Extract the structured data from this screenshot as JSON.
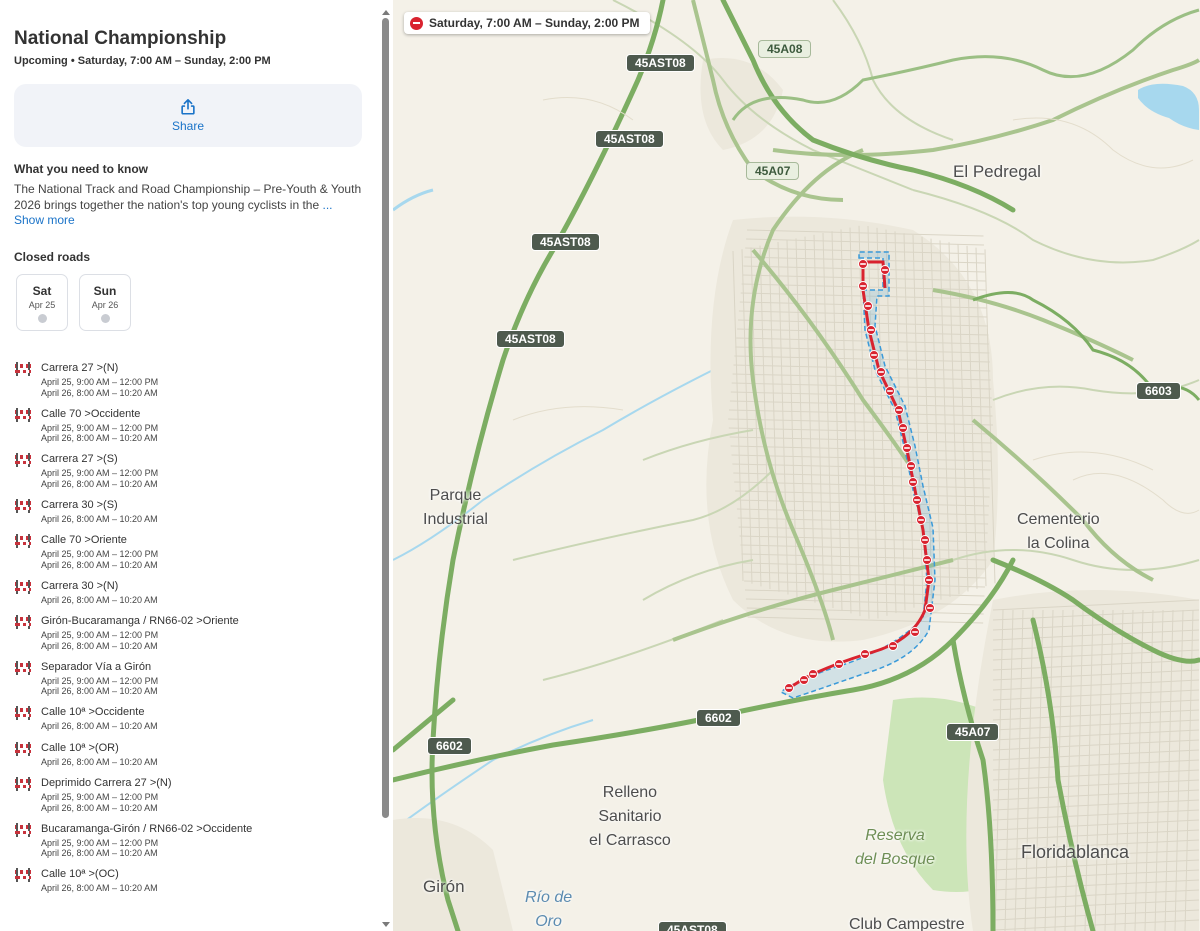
{
  "event": {
    "title": "National Championship",
    "subtitle": "Upcoming • Saturday, 7:00 AM – Sunday, 2:00 PM"
  },
  "share": {
    "label": "Share",
    "icon": "share-icon"
  },
  "info": {
    "heading": "What you need to know",
    "text": "The National Track and Road Championship – Pre-Youth & Youth 2026 brings together the nation's top young cyclists in the",
    "ellipsis": "...",
    "show_more": "Show more"
  },
  "closed_roads": {
    "heading": "Closed roads",
    "days": [
      {
        "name": "Sat",
        "date": "Apr 25"
      },
      {
        "name": "Sun",
        "date": "Apr 26"
      }
    ],
    "roads": [
      {
        "name": "Carrera 27 >(N)",
        "times": [
          "April 25, 9:00 AM – 12:00 PM",
          "April 26, 8:00 AM – 10:20 AM"
        ]
      },
      {
        "name": "Calle 70 >Occidente",
        "times": [
          "April 25, 9:00 AM – 12:00 PM",
          "April 26, 8:00 AM – 10:20 AM"
        ]
      },
      {
        "name": "Carrera 27 >(S)",
        "times": [
          "April 25, 9:00 AM – 12:00 PM",
          "April 26, 8:00 AM – 10:20 AM"
        ]
      },
      {
        "name": "Carrera 30 >(S)",
        "times": [
          "April 26, 8:00 AM – 10:20 AM"
        ]
      },
      {
        "name": "Calle 70 >Oriente",
        "times": [
          "April 25, 9:00 AM – 12:00 PM",
          "April 26, 8:00 AM – 10:20 AM"
        ]
      },
      {
        "name": "Carrera 30 >(N)",
        "times": [
          "April 26, 8:00 AM – 10:20 AM"
        ]
      },
      {
        "name": "Girón-Bucaramanga / RN66-02 >Oriente",
        "times": [
          "April 25, 9:00 AM – 12:00 PM",
          "April 26, 8:00 AM – 10:20 AM"
        ]
      },
      {
        "name": "Separador Vía a Girón",
        "times": [
          "April 25, 9:00 AM – 12:00 PM",
          "April 26, 8:00 AM – 10:20 AM"
        ]
      },
      {
        "name": "Calle 10ª >Occidente",
        "times": [
          "April 26, 8:00 AM – 10:20 AM"
        ]
      },
      {
        "name": "Calle 10ª >(OR)",
        "times": [
          "April 26, 8:00 AM – 10:20 AM"
        ]
      },
      {
        "name": "Deprimido Carrera 27 >(N)",
        "times": [
          "April 25, 9:00 AM – 12:00 PM",
          "April 26, 8:00 AM – 10:20 AM"
        ]
      },
      {
        "name": "Bucaramanga-Girón / RN66-02 >Occidente",
        "times": [
          "April 25, 9:00 AM – 12:00 PM",
          "April 26, 8:00 AM – 10:20 AM"
        ]
      },
      {
        "name": "Calle 10ª >(OC)",
        "times": [
          "April 26, 8:00 AM – 10:20 AM"
        ]
      }
    ]
  },
  "map": {
    "time_pill": "Saturday, 7:00 AM – Sunday, 2:00 PM",
    "shields": [
      "45A08",
      "45AST08",
      "45AST08",
      "45A07",
      "45AST08",
      "45AST08",
      "6603",
      "6602",
      "6602",
      "45A07",
      "45AST08"
    ],
    "places": {
      "el_pedregal": "El Pedregal",
      "parque_industrial": "Parque\nIndustrial",
      "cementerio": "Cementerio\nla Colina",
      "relleno": "Relleno\nSanitario\nel Carrasco",
      "reserva": "Reserva\ndel Bosque",
      "floridablanca": "Floridablanca",
      "giron": "Girón",
      "rio_de_oro": "Río de\nOro",
      "club_campestre": "Club Campestre"
    },
    "colors": {
      "closure_red": "#d9232f",
      "route_outline": "#3a9ad9",
      "highway_green": "#7cad62",
      "water": "#a7d8ee"
    }
  }
}
